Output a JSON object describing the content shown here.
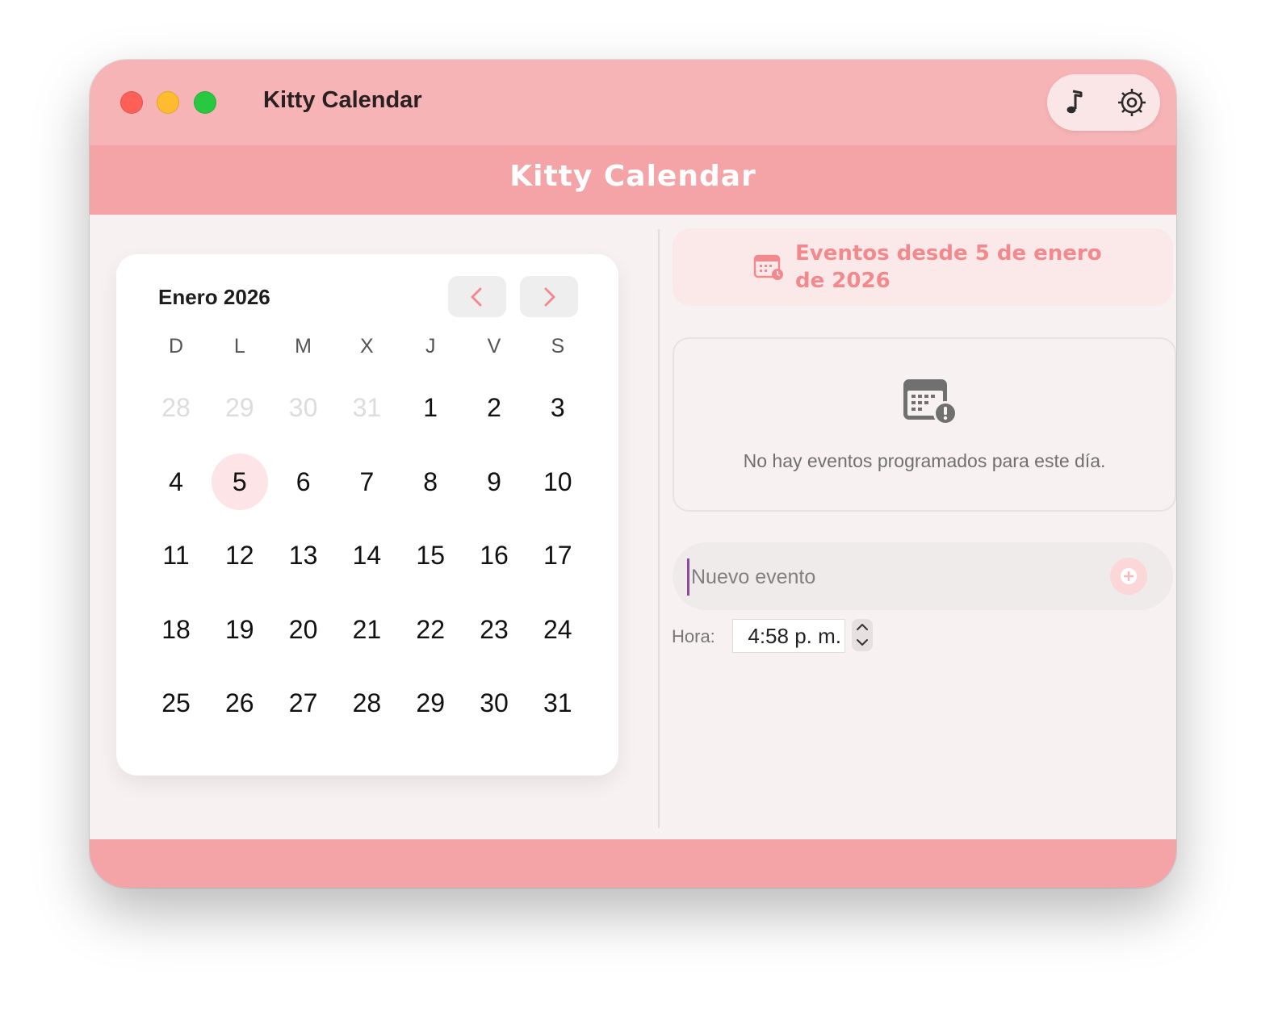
{
  "window": {
    "title": "Kitty Calendar"
  },
  "toolbar": {
    "music_icon": "music-note-icon",
    "settings_icon": "gear-icon"
  },
  "header": {
    "banner_title": "Kitty Calendar"
  },
  "calendar": {
    "month_label": "Enero 2026",
    "prev_icon": "chevron-left-icon",
    "next_icon": "chevron-right-icon",
    "weekdays": [
      "D",
      "L",
      "M",
      "X",
      "J",
      "V",
      "S"
    ],
    "weeks": [
      [
        {
          "d": "28",
          "other": true
        },
        {
          "d": "29",
          "other": true
        },
        {
          "d": "30",
          "other": true
        },
        {
          "d": "31",
          "other": true
        },
        {
          "d": "1"
        },
        {
          "d": "2"
        },
        {
          "d": "3"
        }
      ],
      [
        {
          "d": "4"
        },
        {
          "d": "5",
          "selected": true
        },
        {
          "d": "6"
        },
        {
          "d": "7"
        },
        {
          "d": "8"
        },
        {
          "d": "9"
        },
        {
          "d": "10"
        }
      ],
      [
        {
          "d": "11"
        },
        {
          "d": "12"
        },
        {
          "d": "13"
        },
        {
          "d": "14"
        },
        {
          "d": "15"
        },
        {
          "d": "16"
        },
        {
          "d": "17"
        }
      ],
      [
        {
          "d": "18"
        },
        {
          "d": "19"
        },
        {
          "d": "20"
        },
        {
          "d": "21"
        },
        {
          "d": "22"
        },
        {
          "d": "23"
        },
        {
          "d": "24"
        }
      ],
      [
        {
          "d": "25"
        },
        {
          "d": "26"
        },
        {
          "d": "27"
        },
        {
          "d": "28"
        },
        {
          "d": "29"
        },
        {
          "d": "30"
        },
        {
          "d": "31"
        }
      ]
    ]
  },
  "events": {
    "range_line1": "Eventos desde 5 de enero",
    "range_line2": "de 2026",
    "empty_message": "No hay eventos programados para este día.",
    "new_event_placeholder": "Nuevo evento",
    "new_event_value": "",
    "time_label": "Hora:",
    "time_value": "4:58 p. m."
  },
  "colors": {
    "titlebar": "#f7b4b6",
    "banner": "#f4a4a7",
    "accent_text": "#f2898d",
    "selected_day": "#fde4e6"
  }
}
